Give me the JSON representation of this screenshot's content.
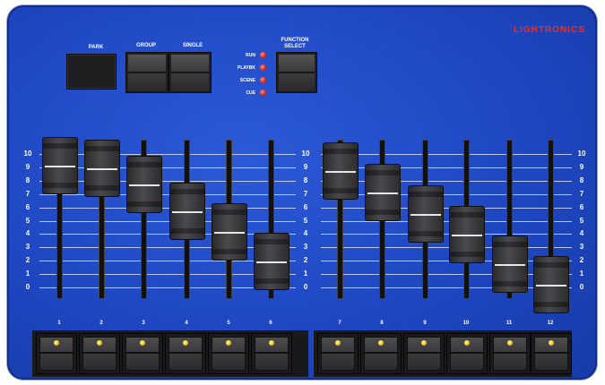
{
  "brand": "LIGHTRONICS",
  "top_controls": {
    "park_label": "PARK",
    "group_label": "GROUP",
    "single_label": "SINGLE",
    "function_label": "FUNCTION SELECT",
    "mode_leds": [
      {
        "label": "RUN"
      },
      {
        "label": "PLAYBK"
      },
      {
        "label": "SCENE"
      },
      {
        "label": "CUE"
      }
    ]
  },
  "scale_left": [
    "10",
    "9",
    "8",
    "7",
    "6",
    "5",
    "4",
    "3",
    "2",
    "1",
    "0"
  ],
  "scale_mid": [
    "10",
    "9",
    "8",
    "7",
    "6",
    "5",
    "4",
    "3",
    "2",
    "1",
    "0"
  ],
  "scale_right": [
    "10",
    "9",
    "8",
    "7",
    "6",
    "5",
    "4",
    "3",
    "2",
    "1",
    "0"
  ],
  "channels": [
    {
      "number": "1",
      "level": 0.92
    },
    {
      "number": "2",
      "level": 0.9
    },
    {
      "number": "3",
      "level": 0.78
    },
    {
      "number": "4",
      "level": 0.58
    },
    {
      "number": "5",
      "level": 0.42
    },
    {
      "number": "6",
      "level": 0.2
    },
    {
      "number": "7",
      "level": 0.88
    },
    {
      "number": "8",
      "level": 0.72
    },
    {
      "number": "9",
      "level": 0.56
    },
    {
      "number": "10",
      "level": 0.4
    },
    {
      "number": "11",
      "level": 0.18
    },
    {
      "number": "12",
      "level": 0.03
    }
  ],
  "colors": {
    "panel": "#1f47c2",
    "brand_text": "#e8302a",
    "led_red": "#d92b1c",
    "led_yellow": "#e8c21a"
  }
}
